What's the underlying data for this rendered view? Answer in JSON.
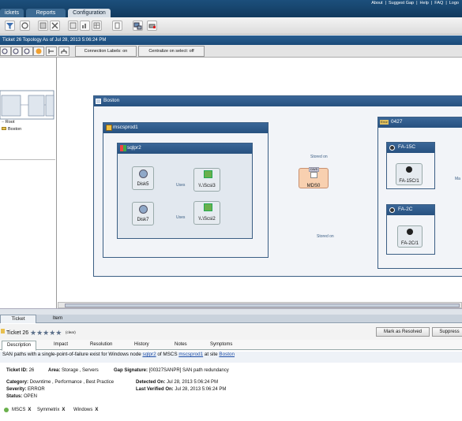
{
  "header": {
    "tabs": [
      {
        "label": "ickets"
      },
      {
        "label": "Reports"
      },
      {
        "label": "Configuration"
      }
    ],
    "links": [
      "About",
      "|",
      "Suggest Gap",
      "|",
      "Help",
      "|",
      "FAQ",
      "|",
      "Logo"
    ]
  },
  "title_bar": "Ticket 26 Topology As of Jul 28, 2013 5:06:24 PM",
  "toolbar2": {
    "connection_labels": "Connection Labels: on",
    "centralize": "Centralize on select: off"
  },
  "tree": {
    "root": "Root",
    "child": "Boston"
  },
  "topology": {
    "site_boston": "Boston",
    "host": "mscsprod1",
    "cluster": "sqlpr2",
    "disks": [
      "Disk5",
      "Disk7"
    ],
    "volumes": [
      "\\\\.\\Scsi3",
      "\\\\.\\Scsi2"
    ],
    "uses_label": "Uses",
    "switch": "MDS0",
    "switch_tag": "DWS",
    "stored_on": "Stored on",
    "site_right": "0427",
    "site_right_badge": "Error",
    "fa": [
      "FA-15C",
      "FA-2C"
    ],
    "fa_ports": [
      "FA-15C/1",
      "FA-2C/1"
    ],
    "edge_cut": "Ma"
  },
  "bottom": {
    "tabs": [
      "Ticket",
      "Item"
    ],
    "ticket_title": "Ticket 26",
    "stars": "★★★★★",
    "rating_note": "(clear)",
    "mark_resolved": "Mark as Resolved",
    "suppress": "Suppress",
    "subtabs": [
      "Description",
      "Impact",
      "Resolution",
      "History",
      "Notes",
      "Symptoms"
    ],
    "description": {
      "prefix": "SAN paths with a single-point-of-failure exist for Windows node",
      "node_link": "sqlpr2",
      "mid": "of MSCS",
      "mscs_link": "mscsprod1",
      "at_site": "at site",
      "site_link": "Boston"
    },
    "fields": {
      "ticket_id_label": "Ticket ID:",
      "ticket_id": "26",
      "area_label": "Area:",
      "area": "Storage , Servers",
      "gap_label": "Gap Signature:",
      "gap": "[00327SANPR] SAN path redundancy",
      "category_label": "Category:",
      "category": "Downtime , Performance , Best Practice",
      "severity_label": "Severity:",
      "severity": "ERROR",
      "status_label": "Status:",
      "status": "OPEN",
      "detected_label": "Detected On:",
      "detected": "Jul 28, 2013 5:06:24 PM",
      "verified_label": "Last Verified On:",
      "verified": "Jul 28, 2013 5:06:24 PM"
    },
    "tags": [
      "MSCS",
      "Symmetrix",
      "Windows"
    ],
    "tag_x": "X"
  },
  "colors": {
    "header": "#1c4f7c",
    "site_header": "#2f5b8c",
    "switch": "#f8d0b0",
    "link": "#1f4fa8",
    "edge": "#3c8ed6"
  }
}
